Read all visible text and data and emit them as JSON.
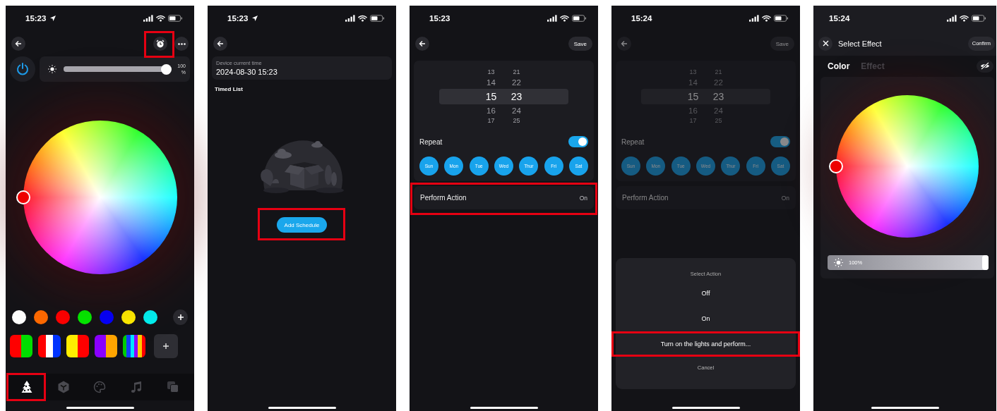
{
  "phones": [
    {
      "kind": "color",
      "status_bar": {
        "time": "15:23",
        "location": true
      },
      "alarm_button": {
        "highlighted": true
      },
      "power": {
        "on": true
      },
      "brightness": {
        "level": 1,
        "reading": "100",
        "unit": "%"
      },
      "swatches": [
        {
          "color": "#ffffff"
        },
        {
          "color": "#ff6a00"
        },
        {
          "color": "#ff0000"
        },
        {
          "color": "#00ee00"
        },
        {
          "color": "#0000ff"
        },
        {
          "color": "#ffee00"
        },
        {
          "color": "#00f0f0"
        }
      ],
      "presets": [
        {
          "stops": [
            {
              "color": "#ff0000"
            },
            {
              "color": "#00dd00"
            }
          ]
        },
        {
          "stops": [
            {
              "color": "#ff0000"
            },
            {
              "color": "#ffffff"
            },
            {
              "color": "#0033ff"
            }
          ]
        },
        {
          "stops": [
            {
              "color": "#ffee00"
            },
            {
              "color": "#ff0000"
            }
          ]
        },
        {
          "stops": [
            {
              "color": "#8a00ff"
            },
            {
              "color": "#ffa500"
            }
          ]
        },
        {
          "stops": [
            {
              "color": "#00cc00"
            },
            {
              "color": "#1040ff"
            },
            {
              "color": "#00e5ff"
            },
            {
              "color": "#8a00ff"
            },
            {
              "color": "#ffcc00"
            },
            {
              "color": "#ff0000"
            }
          ]
        }
      ],
      "tabs": [
        {
          "selected": true,
          "highlighted": true
        },
        {
          "selected": false
        },
        {
          "selected": false
        },
        {
          "selected": false
        },
        {
          "selected": false
        }
      ]
    },
    {
      "kind": "schedule",
      "status_bar": {
        "time": "15:23",
        "location": true
      },
      "device_time_label": "Device current time",
      "device_time": "2024-08-30 15:23",
      "list_title": "Timed List",
      "add_button": {
        "label": "Add Schedule",
        "highlighted": true
      }
    },
    {
      "kind": "timer",
      "status_bar": {
        "time": "15:23"
      },
      "dimmed": false,
      "save": "Save",
      "hours": {
        "above": [
          "13",
          "14"
        ],
        "selected": "15",
        "below": [
          "16",
          "17"
        ]
      },
      "minutes": {
        "above": [
          "21",
          "22"
        ],
        "selected": "23",
        "below": [
          "24",
          "25"
        ]
      },
      "repeat": {
        "label": "Repeat",
        "on": true
      },
      "days": [
        {
          "label": "Sun",
          "selected": true
        },
        {
          "label": "Mon",
          "selected": true
        },
        {
          "label": "Tue",
          "selected": true
        },
        {
          "label": "Wed",
          "selected": true
        },
        {
          "label": "Thur",
          "selected": true
        },
        {
          "label": "Fri",
          "selected": true
        },
        {
          "label": "Sat",
          "selected": true
        }
      ],
      "action": {
        "label": "Perform Action",
        "value": "On",
        "highlighted": true
      }
    },
    {
      "kind": "timer",
      "status_bar": {
        "time": "15:24"
      },
      "dimmed": true,
      "save": "Save",
      "hours": {
        "above": [
          "13",
          "14"
        ],
        "selected": "15",
        "below": [
          "16",
          "17"
        ]
      },
      "minutes": {
        "above": [
          "21",
          "22"
        ],
        "selected": "23",
        "below": [
          "24",
          "25"
        ]
      },
      "repeat": {
        "label": "Repeat",
        "on": true
      },
      "days": [
        {
          "label": "Sun",
          "selected": true
        },
        {
          "label": "Mon",
          "selected": true
        },
        {
          "label": "Tue",
          "selected": true
        },
        {
          "label": "Wed",
          "selected": true
        },
        {
          "label": "Thur",
          "selected": true
        },
        {
          "label": "Fri",
          "selected": true
        },
        {
          "label": "Sat",
          "selected": true
        }
      ],
      "action": {
        "label": "Perform Action",
        "value": "On"
      },
      "sheet": {
        "title": "Select Action",
        "options": [
          {
            "label": "Off",
            "highlighted": false
          },
          {
            "label": "On",
            "highlighted": false
          },
          {
            "label": "Turn on the lights and perform...",
            "highlighted": true
          }
        ],
        "cancel": "Cancel"
      }
    },
    {
      "kind": "effect",
      "status_bar": {
        "time": "15:24"
      },
      "title": "Select Effect",
      "confirm": "Confirm",
      "tabs": [
        {
          "label": "Color",
          "selected": true
        },
        {
          "label": "Effect",
          "selected": false
        }
      ],
      "brightness": {
        "level": 1,
        "reading": "100%"
      }
    }
  ]
}
